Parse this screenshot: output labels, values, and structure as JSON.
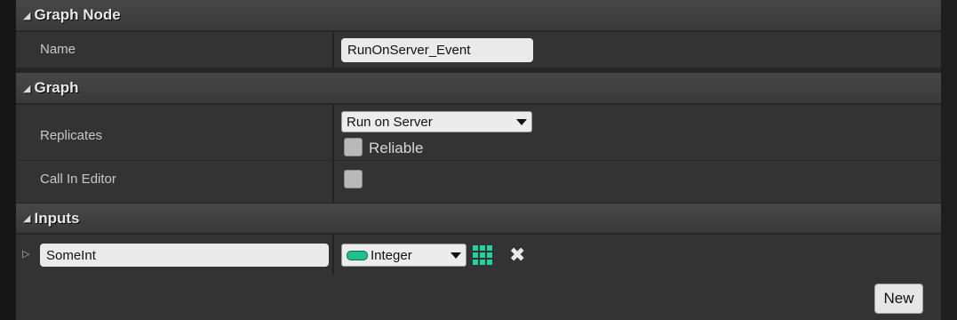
{
  "graph_node": {
    "title": "Graph Node",
    "name_label": "Name",
    "name_value": "RunOnServer_Event"
  },
  "graph": {
    "title": "Graph",
    "replicates_label": "Replicates",
    "replicates_value": "Run on Server",
    "reliable_label": "Reliable",
    "reliable_checked": false,
    "call_in_editor_label": "Call In Editor",
    "call_in_editor_checked": false
  },
  "inputs": {
    "title": "Inputs",
    "params": [
      {
        "name": "SomeInt",
        "type": "Integer",
        "type_color": "#1fbf8f"
      }
    ],
    "new_label": "New"
  },
  "icons": {
    "section_expand": "triangle-down-icon",
    "param_expand": "triangle-right-icon",
    "type_pill": "integer-pill-icon",
    "container_type": "array-grid-icon",
    "remove": "close-icon"
  },
  "colors": {
    "panel_bg": "#262626",
    "row_bg": "#333333",
    "header_bg": "#3e3e3e",
    "accent_integer": "#1fbf8f"
  }
}
